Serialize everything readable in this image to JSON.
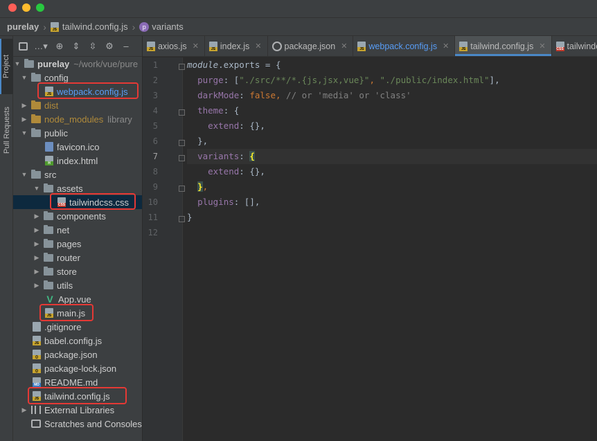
{
  "breadcrumb": {
    "project": "purelay",
    "file": "tailwind.config.js",
    "symbol": "variants"
  },
  "toolwindows": {
    "project": "Project",
    "pull_requests": "Pull Requests"
  },
  "tree": {
    "root_name": "purelay",
    "root_path": "~/work/vue/pure",
    "config": "config",
    "webpack": "webpack.config.js",
    "dist": "dist",
    "node_modules": "node_modules",
    "node_modules_hint": "library",
    "public": "public",
    "favicon": "favicon.ico",
    "index_html": "index.html",
    "src": "src",
    "assets": "assets",
    "tailwindcss": "tailwindcss.css",
    "components": "components",
    "net": "net",
    "pages": "pages",
    "router": "router",
    "store": "store",
    "utils": "utils",
    "app_vue": "App.vue",
    "main_js": "main.js",
    "gitignore": ".gitignore",
    "babel": "babel.config.js",
    "package_json": "package.json",
    "package_lock": "package-lock.json",
    "readme": "README.md",
    "tailwind_config": "tailwind.config.js",
    "external_libs": "External Libraries",
    "scratches": "Scratches and Consoles"
  },
  "tabs": [
    "axios.js",
    "index.js",
    "package.json",
    "webpack.config.js",
    "tailwind.config.js",
    "tailwindcss"
  ],
  "line_numbers": [
    "1",
    "2",
    "3",
    "4",
    "5",
    "6",
    "7",
    "8",
    "9",
    "10",
    "11",
    "12"
  ],
  "code": {
    "l1_kw": "module",
    "l1_rest": ".exports = {",
    "l2_prop": "purge",
    "l2_colon": ": [",
    "l2_s1": "\"./src/**/*.{js,jsx,vue}\"",
    "l2_comma": ", ",
    "l2_s2": "\"./public/index.html\"",
    "l2_end": "],",
    "l3_prop": "darkMode",
    "l3_colon": ": ",
    "l3_kw": "false",
    "l3_comma": ", ",
    "l3_cmt": "// or 'media' or 'class'",
    "l4_prop": "theme",
    "l4_rest": ": {",
    "l5_prop": "extend",
    "l5_rest": ": {},",
    "l6_rest": "},",
    "l7_prop": "variants",
    "l7_colon": ": ",
    "l7_brace": "{",
    "l8_prop": "extend",
    "l8_rest": ": {},",
    "l9_brace": "}",
    "l9_comma": ",",
    "l10_prop": "plugins",
    "l10_rest": ": [],",
    "l11_rest": "}"
  }
}
